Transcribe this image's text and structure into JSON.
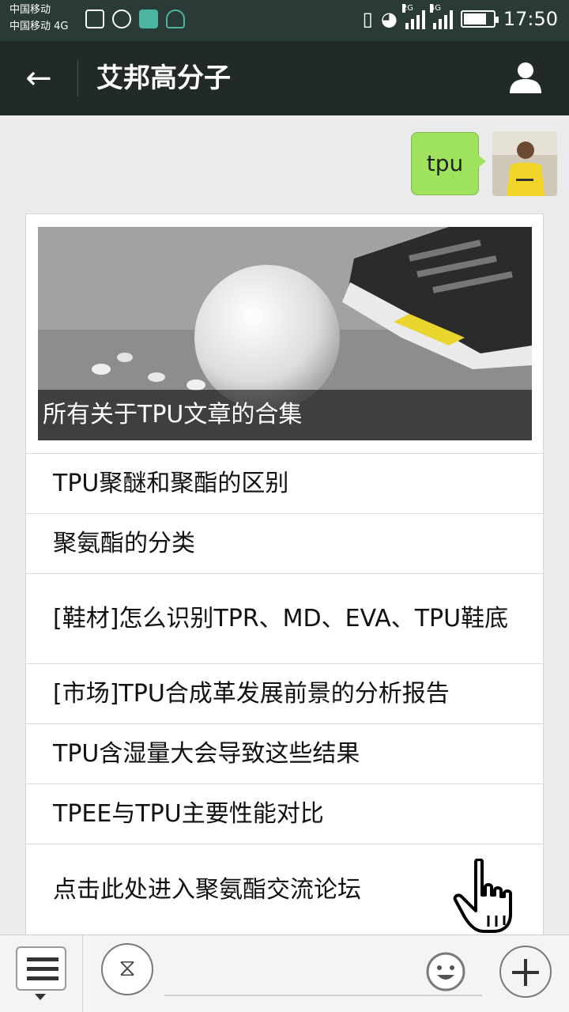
{
  "status_bar": {
    "carrier_1": "中国移动",
    "carrier_2": "中国移动 4G",
    "net_2g": "2G",
    "net_4g": "4G",
    "time": "17:50",
    "icons": [
      "gallery-icon",
      "wechat-icon",
      "app-icon",
      "headset-chat-icon",
      "vibrate-icon",
      "wifi-icon",
      "signal-icon",
      "battery-icon"
    ]
  },
  "header": {
    "title": "艾邦高分子",
    "back_icon": "arrow-left-icon",
    "profile_icon": "person-icon"
  },
  "chat": {
    "sent_message": "tpu"
  },
  "card": {
    "cover_title": "所有关于TPU文章的合集",
    "items": [
      "TPU聚醚和聚酯的区别",
      "聚氨酯的分类",
      "[鞋材]怎么识别TPR、MD、EVA、TPU鞋底",
      "[市场]TPU合成革发展前景的分析报告",
      "TPU含湿量大会导致这些结果",
      "TPEE与TPU主要性能对比",
      "点击此处进入聚氨酯交流论坛"
    ]
  },
  "bottom_bar": {
    "menu_icon": "menu-list-icon",
    "voice_icon": "voice-icon",
    "emoji_icon": "emoji-icon",
    "plus_icon": "plus-icon"
  },
  "colors": {
    "header_bg": "#222a28",
    "bubble_green": "#9ee25e",
    "page_bg": "#ebebeb"
  }
}
